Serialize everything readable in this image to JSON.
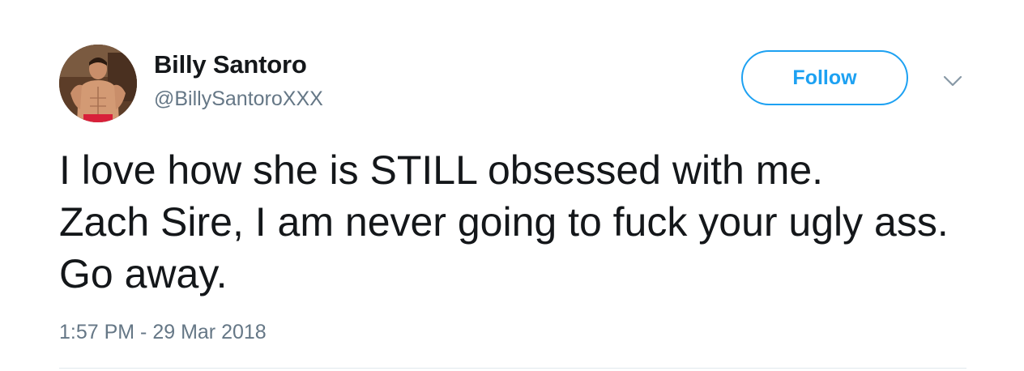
{
  "tweet": {
    "author": {
      "display_name": "Billy Santoro",
      "handle": "@BillySantoroXXX",
      "avatar_icon": "profile-photo-avatar"
    },
    "follow_label": "Follow",
    "menu_icon": "chevron-down-icon",
    "text": "I love how she is STILL obsessed with me.\nZach Sire, I am never going to fuck your ugly ass.  Go away.",
    "timestamp": "1:57 PM - 29 Mar 2018"
  },
  "colors": {
    "accent": "#1da1f2",
    "text_primary": "#14171a",
    "text_secondary": "#657786",
    "divider": "#e1e8ed"
  }
}
